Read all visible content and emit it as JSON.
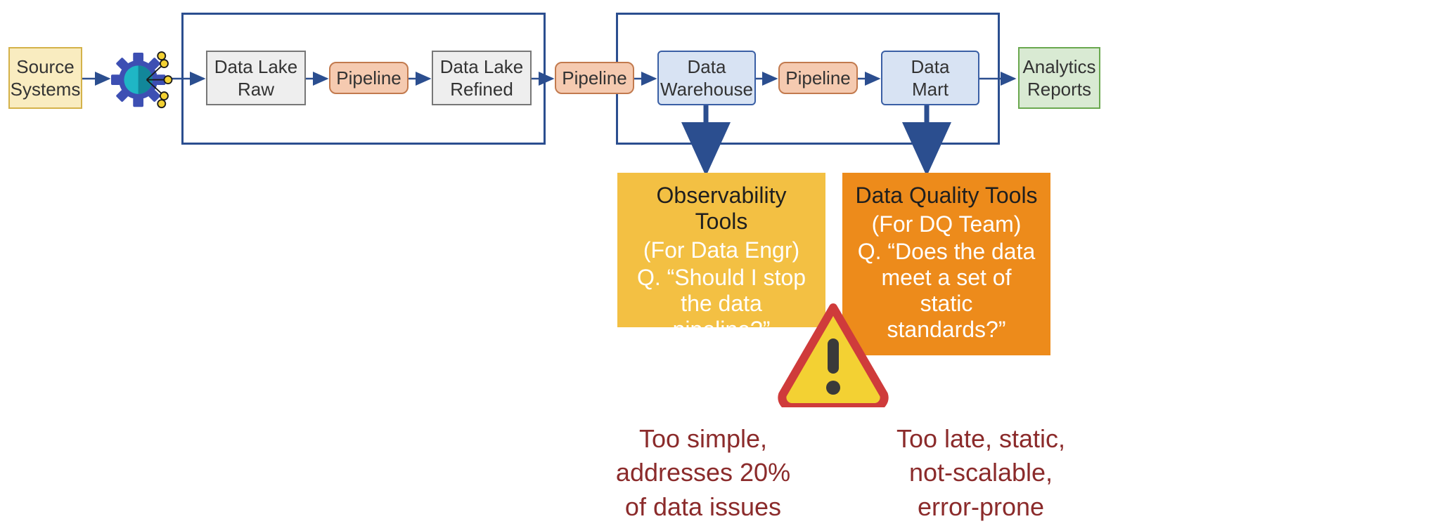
{
  "nodes": {
    "source_systems": "Source\nSystems",
    "data_lake_raw": "Data Lake\nRaw",
    "pipeline1": "Pipeline",
    "data_lake_refined": "Data Lake\nRefined",
    "pipeline2": "Pipeline",
    "data_warehouse": "Data\nWarehouse",
    "pipeline3": "Pipeline",
    "data_mart": "Data\nMart",
    "analytics": "Analytics\nReports"
  },
  "callouts": {
    "observability": {
      "title": "Observability Tools",
      "sub1": "(For Data Engr)",
      "sub2": "Q. “Should I stop",
      "sub3": "the data pipeline?”",
      "issue": "Too simple,\naddresses 20%\nof data issues"
    },
    "dq": {
      "title": "Data Quality Tools",
      "sub1": "(For DQ Team)",
      "sub2": "Q. “Does the data",
      "sub3": "meet a set of static",
      "sub4": "standards?”",
      "issue": "Too late, static,\nnot-scalable,\nerror-prone"
    }
  },
  "colors": {
    "box_border": "#2b4e8f",
    "source_fill": "#f9ecc0",
    "source_stroke": "#d4b24a",
    "gray_fill": "#eeeeee",
    "gray_stroke": "#777777",
    "pipeline_fill": "#f5cab0",
    "pipeline_stroke": "#c27a4e",
    "wh_fill": "#d8e3f3",
    "wh_stroke": "#3a5fa5",
    "analytics_fill": "#d9ead3",
    "analytics_stroke": "#6aa84f",
    "arrow": "#2b4e8f",
    "obs_fill": "#f3c043",
    "dq_fill": "#ed8b1b",
    "warn_fill": "#f3d133",
    "warn_stroke": "#cf3b3b",
    "issue_text": "#8b2b2b"
  }
}
